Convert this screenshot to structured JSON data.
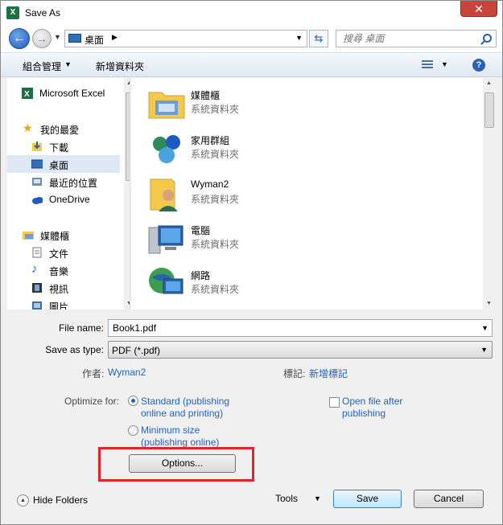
{
  "window": {
    "title": "Save As",
    "app_icon_label": "X",
    "close_label": "✕"
  },
  "nav_buttons": {
    "back": "←",
    "forward": "→",
    "history": "▼"
  },
  "address": {
    "location": "桌面",
    "separator": "▶",
    "dropdown": "▼"
  },
  "search": {
    "placeholder": "搜尋 桌面"
  },
  "toolbar": {
    "organize": "組合管理",
    "organize_arrow": "▼",
    "new_folder": "新增資料夾",
    "view_arrow": "▼",
    "help": "?"
  },
  "sidebar": {
    "items": [
      {
        "label": "Microsoft Excel",
        "icon": "excel-icon"
      },
      {
        "label": "我的最愛",
        "icon": "star-icon"
      },
      {
        "label": "下載",
        "icon": "downloads-icon"
      },
      {
        "label": "桌面",
        "icon": "desktop-icon",
        "selected": true
      },
      {
        "label": "最近的位置",
        "icon": "recent-places-icon"
      },
      {
        "label": "OneDrive",
        "icon": "onedrive-icon"
      },
      {
        "label": "媒體櫃",
        "icon": "libraries-icon"
      },
      {
        "label": "文件",
        "icon": "documents-icon"
      },
      {
        "label": "音樂",
        "icon": "music-icon"
      },
      {
        "label": "視訊",
        "icon": "videos-icon"
      },
      {
        "label": "圖片",
        "icon": "pictures-icon"
      }
    ]
  },
  "files": [
    {
      "name": "媒體櫃",
      "type": "系統資料夾",
      "icon": "libraries-folder-icon"
    },
    {
      "name": "家用群組",
      "type": "系統資料夾",
      "icon": "homegroup-icon"
    },
    {
      "name": "Wyman2",
      "type": "系統資料夾",
      "icon": "user-folder-icon"
    },
    {
      "name": "電腦",
      "type": "系統資料夾",
      "icon": "computer-icon"
    },
    {
      "name": "網路",
      "type": "系統資料夾",
      "icon": "network-icon"
    }
  ],
  "form": {
    "file_name_label": "File name:",
    "file_name_value": "Book1.pdf",
    "save_type_label": "Save as type:",
    "save_type_value": "PDF (*.pdf)",
    "dropdown_arrow": "▼",
    "author_label": "作者:",
    "author_value": "Wyman2",
    "tags_label": "標記:",
    "tags_value": "新增標記"
  },
  "optimize": {
    "label": "Optimize for:",
    "standard_line1": "Standard (publishing",
    "standard_line2": "online and printing)",
    "minimum_line1": "Minimum size",
    "minimum_line2": "(publishing online)",
    "open_after_line1": "Open file after",
    "open_after_line2": "publishing",
    "options_button": "Options..."
  },
  "footer": {
    "hide_folders": "Hide Folders",
    "hide_folders_arrow": "▲",
    "tools": "Tools",
    "tools_arrow": "▼",
    "save": "Save",
    "cancel": "Cancel"
  },
  "colors": {
    "highlight_border": "#e0242c",
    "link_blue": "#2763b5",
    "close_red": "#c7463c"
  }
}
